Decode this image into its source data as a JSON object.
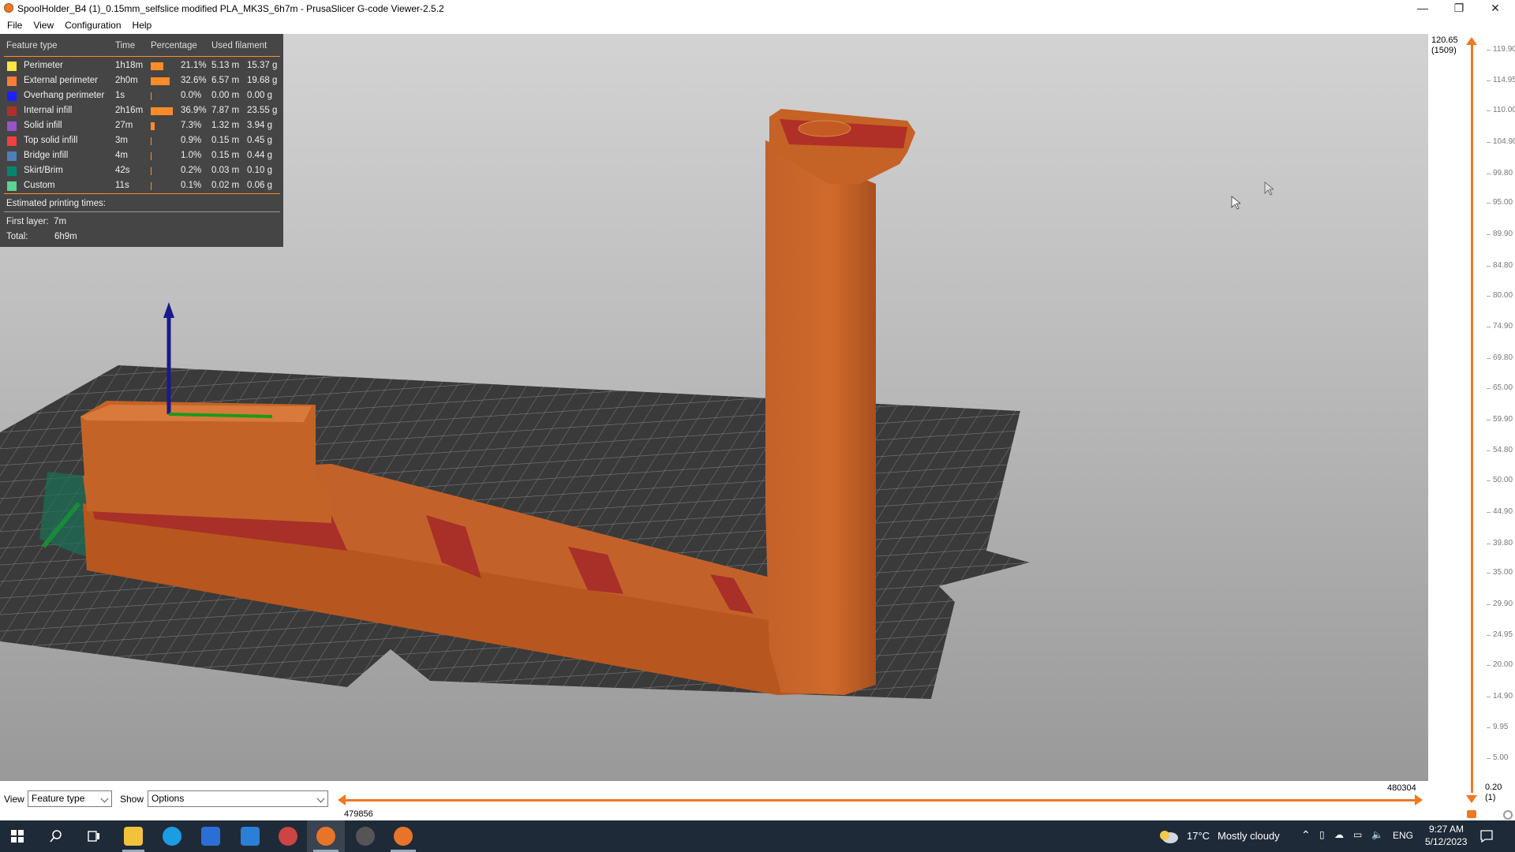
{
  "window": {
    "title": "SpoolHolder_B4 (1)_0.15mm_selfslice modified PLA_MK3S_6h7m - PrusaSlicer G-code Viewer-2.5.2",
    "minimize": "—",
    "restore": "❐",
    "close": "✕"
  },
  "menu": [
    "File",
    "View",
    "Configuration",
    "Help"
  ],
  "legend": {
    "headers": {
      "feature": "Feature type",
      "time": "Time",
      "percentage": "Percentage",
      "used": "Used filament"
    },
    "rows": [
      {
        "name": "Perimeter",
        "color": "#ffe640",
        "time": "1h18m",
        "pct": "21.1%",
        "len": "5.13 m",
        "weight": "15.37 g",
        "fraction": 0.211
      },
      {
        "name": "External perimeter",
        "color": "#ff7d38",
        "time": "2h0m",
        "pct": "32.6%",
        "len": "6.57 m",
        "weight": "19.68 g",
        "fraction": 0.326
      },
      {
        "name": "Overhang perimeter",
        "color": "#1f1fff",
        "time": "1s",
        "pct": "0.0%",
        "len": "0.00 m",
        "weight": "0.00 g",
        "fraction": 0.0
      },
      {
        "name": "Internal infill",
        "color": "#b03029",
        "time": "2h16m",
        "pct": "36.9%",
        "len": "7.87 m",
        "weight": "23.55 g",
        "fraction": 0.369
      },
      {
        "name": "Solid infill",
        "color": "#9654cc",
        "time": "27m",
        "pct": "7.3%",
        "len": "1.32 m",
        "weight": "3.94 g",
        "fraction": 0.073
      },
      {
        "name": "Top solid infill",
        "color": "#f04040",
        "time": "3m",
        "pct": "0.9%",
        "len": "0.15 m",
        "weight": "0.45 g",
        "fraction": 0.009
      },
      {
        "name": "Bridge infill",
        "color": "#4d80ba",
        "time": "4m",
        "pct": "1.0%",
        "len": "0.15 m",
        "weight": "0.44 g",
        "fraction": 0.01
      },
      {
        "name": "Skirt/Brim",
        "color": "#00876e",
        "time": "42s",
        "pct": "0.2%",
        "len": "0.03 m",
        "weight": "0.10 g",
        "fraction": 0.002
      },
      {
        "name": "Custom",
        "color": "#5ed194",
        "time": "11s",
        "pct": "0.1%",
        "len": "0.02 m",
        "weight": "0.06 g",
        "fraction": 0.001
      }
    ],
    "estimated_label": "Estimated printing times:",
    "first_layer_label": "First layer:",
    "first_layer_value": "7m",
    "total_label": "Total:",
    "total_value": "6h9m"
  },
  "vslider": {
    "top_value": "120.65",
    "top_layer": "(1509)",
    "bottom_value": "0.20",
    "bottom_layer": "(1)",
    "ticks": [
      "119.90",
      "114.95",
      "110.00",
      "104.90",
      "99.80",
      "95.00",
      "89.90",
      "84.80",
      "80.00",
      "74.90",
      "69.80",
      "65.00",
      "59.90",
      "54.80",
      "50.00",
      "44.90",
      "39.80",
      "35.00",
      "29.90",
      "24.95",
      "20.00",
      "14.90",
      "9.95",
      "5.00"
    ]
  },
  "bottombar": {
    "view_label": "View",
    "view_value": "Feature type",
    "show_label": "Show",
    "show_value": "Options",
    "h_left_value": "479856",
    "h_right_value": "480304"
  },
  "taskbar": {
    "weather_temp": "17°C",
    "weather_text": "Mostly cloudy",
    "lang": "ENG",
    "time": "9:27 AM",
    "date": "5/12/2023"
  }
}
